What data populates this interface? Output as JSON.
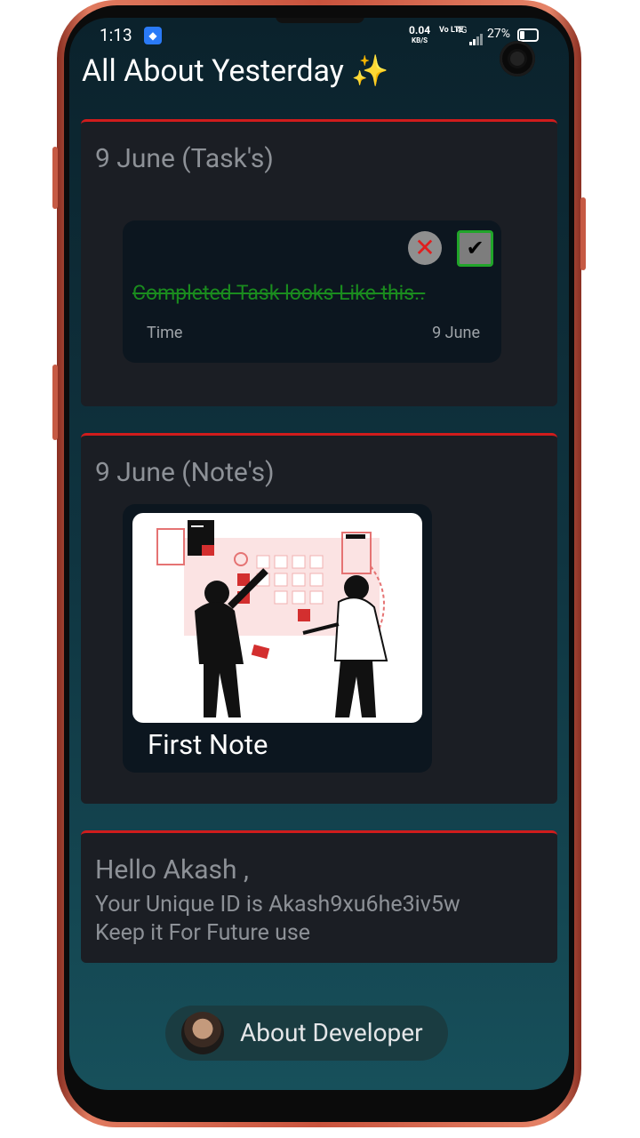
{
  "status_bar": {
    "time": "1:13",
    "net_speed": "0.04",
    "net_speed_unit": "KB/S",
    "volte": "Vo LTE",
    "network": "4G",
    "battery": "27%"
  },
  "page_title": "All About Yesterday ✨",
  "tasks_card": {
    "heading": "9 June (Task's)",
    "task": {
      "text": "Completed Task looks Like this..",
      "time_label": "Time",
      "date": "9 June",
      "status": "completed"
    }
  },
  "notes_card": {
    "heading": "9 June (Note's)",
    "note": {
      "title": "First Note"
    }
  },
  "user_card": {
    "greeting": "Hello Akash ,",
    "unique_id_line": "Your Unique ID is Akash9xu6he3iv5w",
    "keep_line": "Keep it For Future use"
  },
  "about_developer": {
    "label": "About Developer"
  },
  "colors": {
    "accent_red": "#d01c1c",
    "completed_green": "#1a8c1e",
    "card_bg": "#1b1e24",
    "screen_bg": "#0f3440"
  }
}
